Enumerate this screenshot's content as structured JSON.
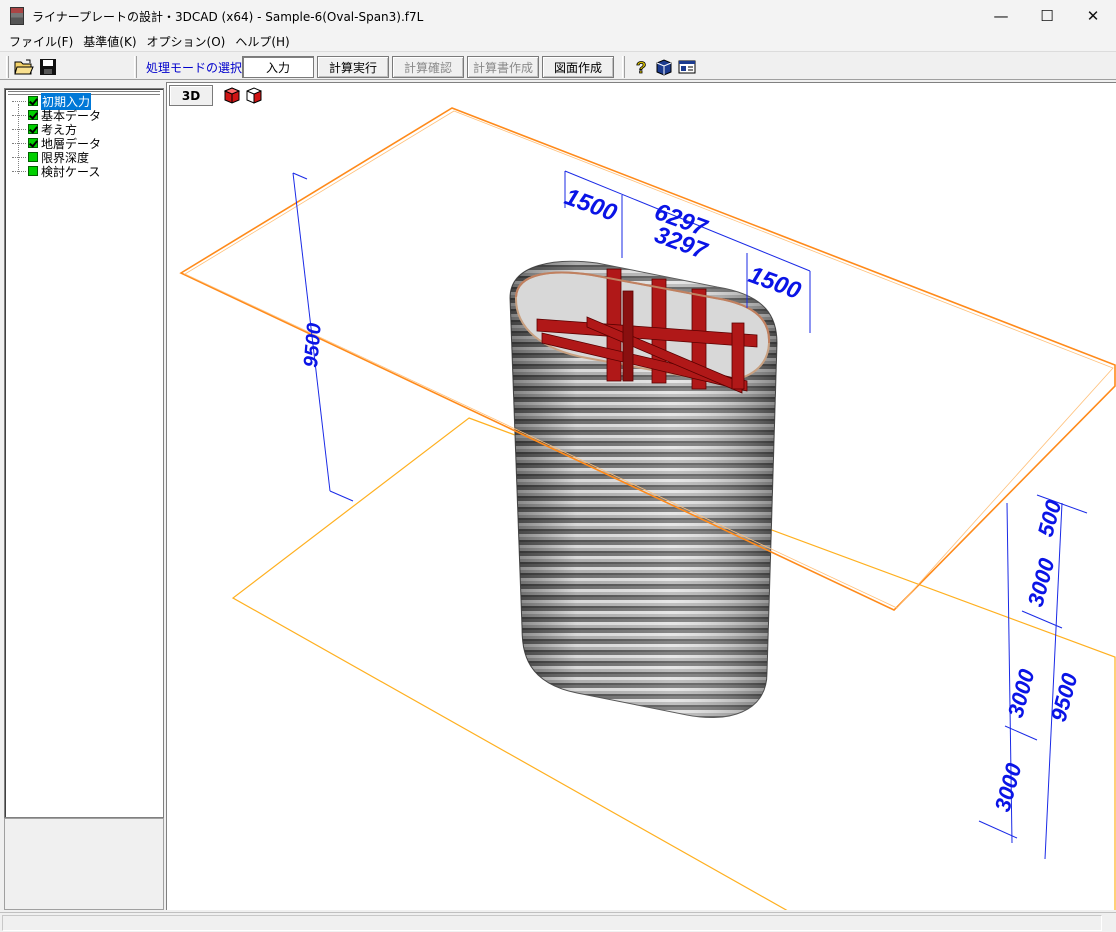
{
  "window": {
    "title": "ライナープレートの設計・3DCAD (x64) - Sample-6(Oval-Span3).f7L",
    "minimize": "—",
    "maximize": "☐",
    "close": "✕"
  },
  "menu": [
    "ファイル(F)",
    "基準値(K)",
    "オプション(O)",
    "ヘルプ(H)"
  ],
  "toolbar": {
    "mode_label": "処理モードの選択",
    "buttons": [
      "入力",
      "計算実行",
      "計算確認",
      "計算書作成",
      "図面作成"
    ],
    "icons": [
      "open-folder-icon",
      "save-icon",
      "help-icon",
      "3d-model-icon",
      "card-icon"
    ]
  },
  "tree": {
    "items": [
      {
        "label": "初期入力",
        "checked": true,
        "selected": true
      },
      {
        "label": "基本データ",
        "checked": true,
        "selected": false
      },
      {
        "label": "考え方",
        "checked": true,
        "selected": false
      },
      {
        "label": "地層データ",
        "checked": true,
        "selected": false
      },
      {
        "label": "限界深度",
        "checked": false,
        "selected": false
      },
      {
        "label": "検討ケース",
        "checked": false,
        "selected": false
      }
    ]
  },
  "view": {
    "mode_button": "3D",
    "dimensions": {
      "total_width": "6297",
      "straight_span": "3297",
      "radius_left": "1500",
      "radius_right": "1500",
      "depth_left": "9500",
      "depth_right": "9500",
      "segment_top": "500",
      "segment_1": "3000",
      "segment_2": "3000",
      "segment_3": "3000"
    },
    "colors": {
      "dimension": "#0a14e6",
      "ground_plane": "#ff9a33",
      "bottom_plane": "#ffb020",
      "strut": "#b01818",
      "shaft": "#8a8a8a"
    }
  }
}
